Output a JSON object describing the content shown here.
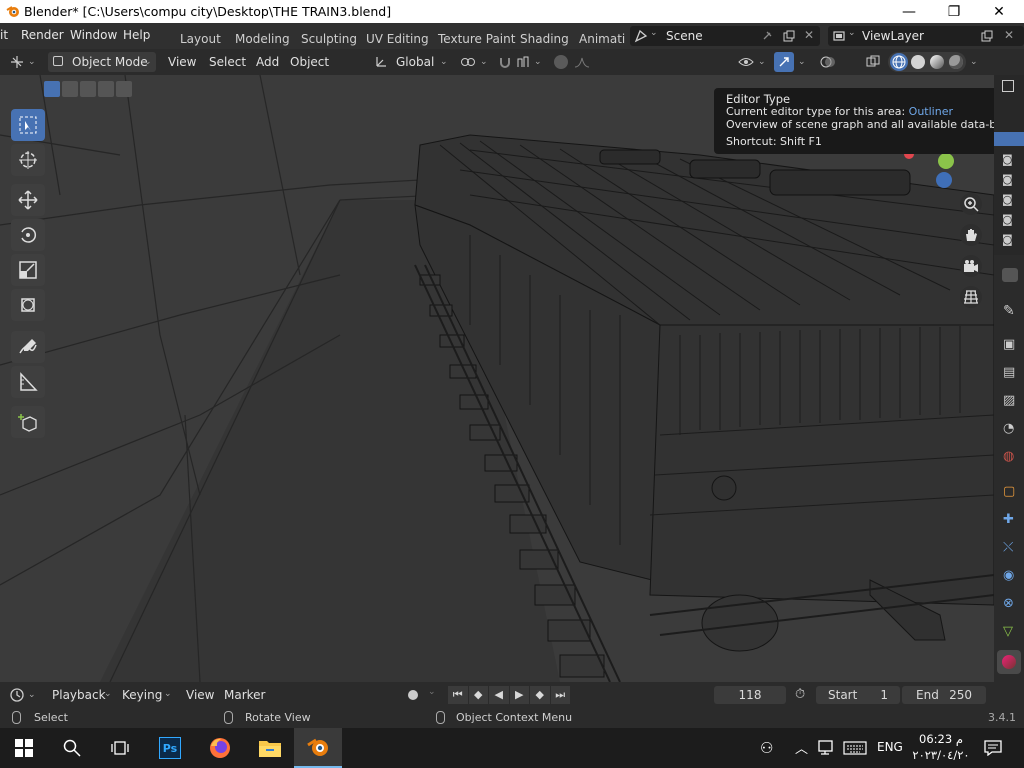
{
  "window": {
    "title": "Blender* [C:\\Users\\compu city\\Desktop\\THE TRAIN3.blend]",
    "minimize": "—",
    "maximize": "❐",
    "close": "✕"
  },
  "topbar": {
    "menus": [
      "it",
      "Render",
      "Window",
      "Help"
    ],
    "workspaces": [
      "Layout",
      "Modeling",
      "Sculpting",
      "UV Editing",
      "Texture Paint",
      "Shading",
      "Animati"
    ],
    "scene": "Scene",
    "viewlayer": "ViewLayer"
  },
  "header": {
    "mode": "Object Mode",
    "menus": [
      "View",
      "Select",
      "Add",
      "Object"
    ],
    "orientation": "Global"
  },
  "tooltip": {
    "title": "Editor Type",
    "line1_prefix": "Current editor type for this area: ",
    "line1_value": "Outliner",
    "line2": "Overview of scene graph and all available data-blocks",
    "line3": "Shortcut: Shift F1"
  },
  "timeline": {
    "menus": [
      "Playback",
      "Keying",
      "View",
      "Marker"
    ],
    "current_frame": "118",
    "start_label": "Start",
    "start_value": "1",
    "end_label": "End",
    "end_value": "250"
  },
  "statusbar": {
    "select": "Select",
    "rotate": "Rotate View",
    "context": "Object Context Menu",
    "version": "3.4.1"
  },
  "taskbar": {
    "lang": "ENG",
    "time": "06:23 م",
    "date": "٢٠٢٣/٠٤/٢٠"
  },
  "colors": {
    "accent": "#4772b3",
    "outliner_link": "#6fa7e8",
    "gizmo_y": "#8bc34a",
    "gizmo_z": "#3f6fb8",
    "gizmo_x": "#e0464e"
  }
}
